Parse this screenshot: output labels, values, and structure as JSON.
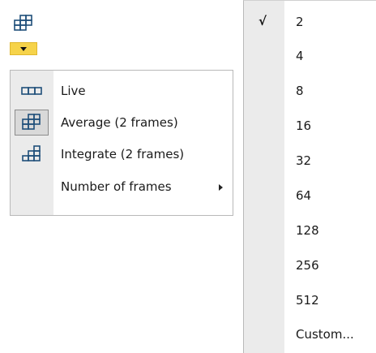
{
  "toolbar": {
    "button_icon": "average-frames-icon",
    "dropdown_icon": "chevron-down-icon",
    "accent_color": "#f6d34a"
  },
  "menu": {
    "items": [
      {
        "label": "Live",
        "icon": "live-icon",
        "selected": false
      },
      {
        "label": "Average (2 frames)",
        "icon": "average-frames-icon",
        "selected": true
      },
      {
        "label": "Integrate (2 frames)",
        "icon": "integrate-frames-icon",
        "selected": false
      },
      {
        "label": "Number of frames",
        "icon": "",
        "has_submenu": true
      }
    ]
  },
  "submenu": {
    "checkmark": "√",
    "items": [
      "2",
      "4",
      "8",
      "16",
      "32",
      "64",
      "128",
      "256",
      "512",
      "Custom..."
    ],
    "checked": "2"
  }
}
